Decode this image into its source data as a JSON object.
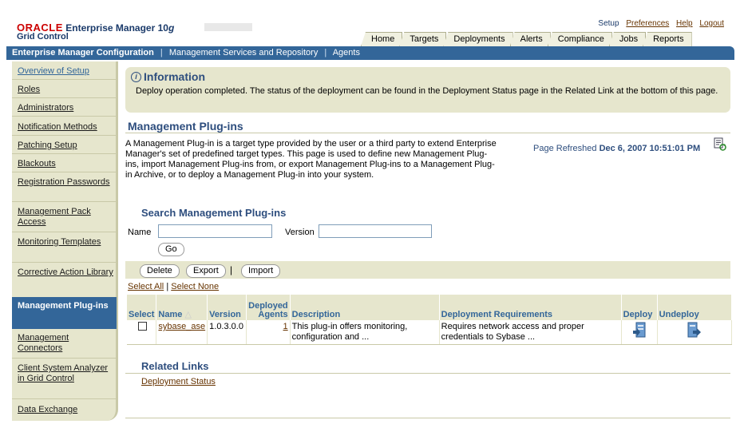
{
  "header": {
    "oracle": "ORACLE",
    "product": "Enterprise Manager 10",
    "version_letter": "g",
    "subtitle": "Grid Control"
  },
  "global_links": [
    "Setup",
    "Preferences",
    "Help",
    "Logout"
  ],
  "tabs": [
    "Home",
    "Targets",
    "Deployments",
    "Alerts",
    "Compliance",
    "Jobs",
    "Reports"
  ],
  "navbar": {
    "current": "Enterprise Manager Configuration",
    "items": [
      "Management Services and Repository",
      "Agents"
    ]
  },
  "sidebar": {
    "items": [
      "Overview of Setup",
      "Roles",
      "Administrators",
      "Notification Methods",
      "Patching Setup",
      "Blackouts",
      "Registration Passwords",
      "Management Pack Access",
      "Monitoring Templates",
      "Corrective Action Library",
      "Management Plug-ins",
      "Management Connectors",
      "Client System Analyzer in Grid Control",
      "Data Exchange"
    ],
    "selected": "Management Plug-ins"
  },
  "info": {
    "title": "Information",
    "text": "Deploy operation completed. The status of the deployment can be found in the Deployment Status page in the Related Link at the bottom of this page."
  },
  "page": {
    "title": "Management Plug-ins",
    "description": "A Management Plug-in is a target type provided by the user or a third party to extend Enterprise Manager's set of predefined target types. This page is used to define new Management Plug-ins, import Management Plug-ins from, or export Management Plug-ins to a Management Plug-in Archive, or to deploy a Management Plug-in into your system.",
    "refreshed_label": "Page Refreshed",
    "refreshed_value": "Dec 6, 2007 10:51:01 PM"
  },
  "search": {
    "title": "Search Management Plug-ins",
    "name_label": "Name",
    "name_value": "",
    "version_label": "Version",
    "version_value": "",
    "go": "Go"
  },
  "actions": {
    "delete": "Delete",
    "export": "Export",
    "import": "Import"
  },
  "select_all": "Select All",
  "select_none": "Select None",
  "table": {
    "headers": {
      "select": "Select",
      "name": "Name",
      "version": "Version",
      "deployed_agents_1": "Deployed",
      "deployed_agents_2": "Agents",
      "description": "Description",
      "requirements": "Deployment Requirements",
      "deploy": "Deploy",
      "undeploy": "Undeploy"
    },
    "rows": [
      {
        "name": "sybase_ase",
        "version": "1.0.3.0.0",
        "deployed_agents": "1",
        "description": "This plug-in offers monitoring, configuration and ...",
        "requirements": "Requires network access and proper credentials to Sybase ..."
      }
    ]
  },
  "related": {
    "title": "Related Links",
    "links": [
      "Deployment Status"
    ]
  },
  "colors": {
    "brand_blue": "#336699",
    "panel_beige": "#e6e6cd",
    "oracle_red": "#cc0000",
    "link_brown": "#663300"
  }
}
